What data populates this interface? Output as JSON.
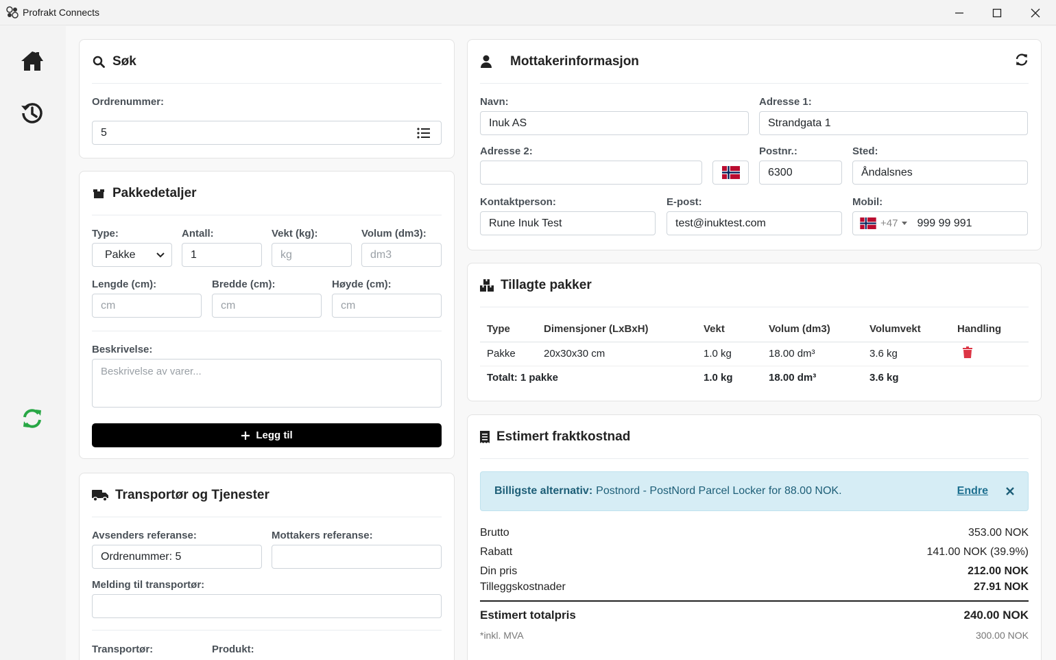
{
  "window": {
    "title": "Profrakt Connects"
  },
  "sidebar": {
    "items": [
      {
        "name": "home"
      },
      {
        "name": "history"
      },
      {
        "name": "sync"
      }
    ]
  },
  "search": {
    "title": "Søk",
    "order_label": "Ordrenummer:",
    "order_value": "5"
  },
  "package": {
    "title": "Pakkedetaljer",
    "type_label": "Type:",
    "type_value": "Pakke",
    "count_label": "Antall:",
    "count_value": "1",
    "weight_label": "Vekt (kg):",
    "weight_placeholder": "kg",
    "volume_label": "Volum (dm3):",
    "volume_placeholder": "dm3",
    "length_label": "Lengde (cm):",
    "width_label": "Bredde (cm):",
    "height_label": "Høyde (cm):",
    "dim_placeholder": "cm",
    "desc_label": "Beskrivelse:",
    "desc_placeholder": "Beskrivelse av varer...",
    "add_label": "Legg til"
  },
  "transport": {
    "title": "Transportør og Tjenester",
    "sender_ref_label": "Avsenders referanse:",
    "sender_ref_value": "Ordrenummer: 5",
    "receiver_ref_label": "Mottakers referanse:",
    "message_label": "Melding til transportør:",
    "carrier_label": "Transportør:",
    "product_label": "Produkt:"
  },
  "recipient": {
    "title": "Mottakerinformasjon",
    "name_label": "Navn:",
    "name_value": "Inuk AS",
    "addr1_label": "Adresse 1:",
    "addr1_value": "Strandgata 1",
    "addr2_label": "Adresse 2:",
    "postal_label": "Postnr.:",
    "postal_value": "6300",
    "city_label": "Sted:",
    "city_value": "Åndalsnes",
    "contact_label": "Kontaktperson:",
    "contact_value": "Rune Inuk Test",
    "email_label": "E-post:",
    "email_value": "test@inuktest.com",
    "mobile_label": "Mobil:",
    "mobile_code": "+47",
    "mobile_value": "999 99 991"
  },
  "packages": {
    "title": "Tillagte pakker",
    "headers": [
      "Type",
      "Dimensjoner (LxBxH)",
      "Vekt",
      "Volum (dm3)",
      "Volumvekt",
      "Handling"
    ],
    "rows": [
      [
        "Pakke",
        "20x30x30 cm",
        "1.0 kg",
        "18.00 dm³",
        "3.6 kg"
      ]
    ],
    "total": [
      "Totalt: 1 pakke",
      "1.0 kg",
      "18.00 dm³",
      "3.6 kg"
    ]
  },
  "cost": {
    "title": "Estimert fraktkostnad",
    "alert_bold": "Billigste alternativ:",
    "alert_text": "Postnord - PostNord Parcel Locker for 88.00 NOK.",
    "alert_link": "Endre",
    "rows": [
      {
        "label": "Brutto",
        "value": "353.00 NOK"
      },
      {
        "label": "Rabatt",
        "value": "141.00 NOK (39.9%)"
      },
      {
        "label": "Din pris",
        "value": "212.00 NOK"
      },
      {
        "label": "Tilleggskostnader",
        "value": "27.91 NOK"
      }
    ],
    "total_label": "Estimert totalpris",
    "total_value": "240.00 NOK",
    "vat_label": "*inkl. MVA",
    "vat_value": "300.00 NOK"
  },
  "colors": {
    "accent": "#000000",
    "sync": "#28a745",
    "danger": "#dc3545",
    "alert_bg": "#d6edf5"
  }
}
